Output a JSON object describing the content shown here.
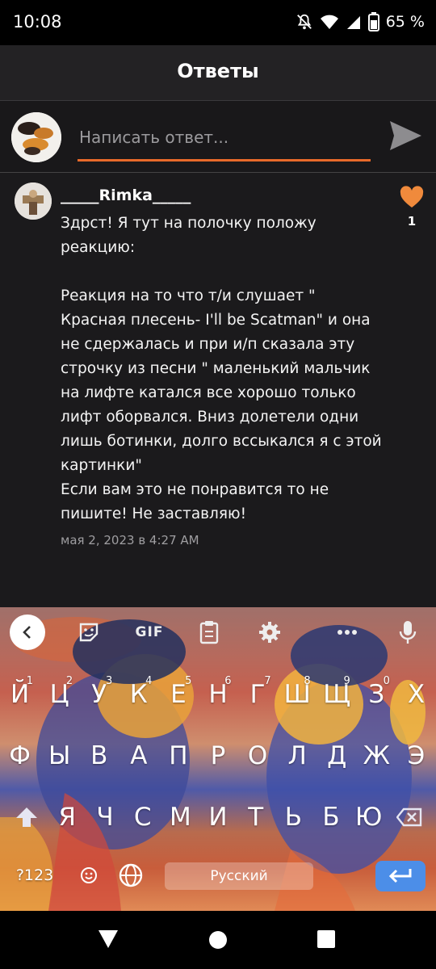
{
  "status_bar": {
    "time": "10:08",
    "battery": "65 %"
  },
  "header": {
    "title": "Ответы"
  },
  "compose": {
    "placeholder": "Написать ответ..."
  },
  "comment": {
    "username": "_____Rimka_____",
    "text": "Здрст! Я тут на полочку положу\nреакцию:\n\nРеакция на то что т/и слушает \"\nКрасная плесень- I'll be Scatman\" и она\nне сдержалась и при и/п сказала эту\nстрочку из песни \" маленький мальчик\nна лифте катался все хорошо только\nлифт оборвался. Вниз долетели одни\nлишь ботинки, долго вссыкался я с этой\nкартинки\"\nЕсли вам это не понравится то не\nпишите! Не заставляю!",
    "timestamp": "мая 2, 2023 в 4:27 AM",
    "likes": "1"
  },
  "keyboard": {
    "toolbar": {
      "gif_label": "GIF"
    },
    "row1": [
      {
        "k": "Й",
        "n": "1"
      },
      {
        "k": "Ц",
        "n": "2"
      },
      {
        "k": "У",
        "n": "3"
      },
      {
        "k": "К",
        "n": "4"
      },
      {
        "k": "Е",
        "n": "5"
      },
      {
        "k": "Н",
        "n": "6"
      },
      {
        "k": "Г",
        "n": "7"
      },
      {
        "k": "Ш",
        "n": "8"
      },
      {
        "k": "Щ",
        "n": "9"
      },
      {
        "k": "З",
        "n": "0"
      },
      {
        "k": "Х",
        "n": ""
      }
    ],
    "row2": [
      "Ф",
      "Ы",
      "В",
      "А",
      "П",
      "Р",
      "О",
      "Л",
      "Д",
      "Ж",
      "Э"
    ],
    "row3": [
      "Я",
      "Ч",
      "С",
      "М",
      "И",
      "Т",
      "Ь",
      "Б",
      "Ю"
    ],
    "symbols_label": "?123",
    "space_label": "Русский"
  },
  "colors": {
    "accent": "#e8692a",
    "heart": "#f08a3c",
    "enter_key": "#4c8ee8"
  }
}
